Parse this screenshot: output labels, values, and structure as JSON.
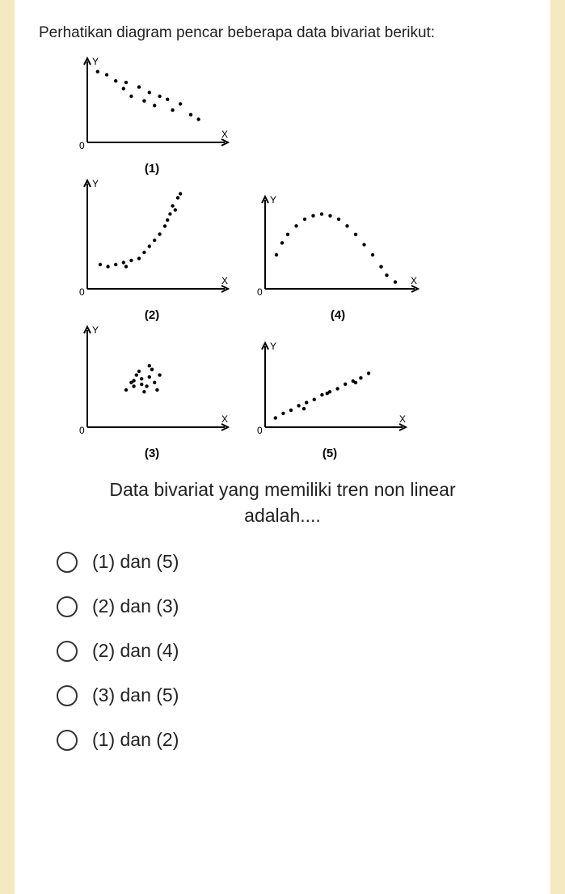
{
  "intro": "Perhatikan diagram pencar beberapa data bivariat berikut:",
  "question_line1": "Data bivariat yang memiliki tren non linear",
  "question_line2": "adalah....",
  "options": [
    "(1) dan (5)",
    "(2) dan (3)",
    "(2) dan (4)",
    "(3) dan (5)",
    "(1) dan (2)"
  ],
  "plots": {
    "p1": {
      "label": "(1)"
    },
    "p2": {
      "label": "(2)"
    },
    "p3": {
      "label": "(3)"
    },
    "p4": {
      "label": "(4)"
    },
    "p5": {
      "label": "(5)"
    }
  },
  "axis": {
    "x": "X",
    "y": "Y",
    "o": "0"
  },
  "chart_data": [
    {
      "type": "scatter",
      "label": "(1)",
      "description": "negative linear trend",
      "points": [
        [
          8,
          92
        ],
        [
          15,
          88
        ],
        [
          22,
          80
        ],
        [
          30,
          78
        ],
        [
          28,
          70
        ],
        [
          40,
          72
        ],
        [
          34,
          60
        ],
        [
          48,
          65
        ],
        [
          44,
          54
        ],
        [
          56,
          60
        ],
        [
          52,
          48
        ],
        [
          62,
          56
        ],
        [
          66,
          42
        ],
        [
          72,
          50
        ],
        [
          80,
          36
        ],
        [
          86,
          30
        ]
      ]
    },
    {
      "type": "scatter",
      "label": "(2)",
      "description": "curved upward (J-shape) non-linear",
      "points": [
        [
          10,
          24
        ],
        [
          16,
          22
        ],
        [
          22,
          24
        ],
        [
          28,
          26
        ],
        [
          34,
          28
        ],
        [
          30,
          22
        ],
        [
          40,
          30
        ],
        [
          44,
          36
        ],
        [
          48,
          42
        ],
        [
          52,
          48
        ],
        [
          56,
          54
        ],
        [
          60,
          62
        ],
        [
          62,
          68
        ],
        [
          64,
          74
        ],
        [
          66,
          82
        ],
        [
          70,
          90
        ],
        [
          68,
          78
        ],
        [
          72,
          94
        ]
      ]
    },
    {
      "type": "scatter",
      "label": "(3)",
      "description": "random cluster, no trend",
      "points": [
        [
          30,
          40
        ],
        [
          36,
          50
        ],
        [
          42,
          46
        ],
        [
          48,
          54
        ],
        [
          40,
          60
        ],
        [
          52,
          48
        ],
        [
          44,
          38
        ],
        [
          56,
          56
        ],
        [
          34,
          48
        ],
        [
          50,
          62
        ],
        [
          46,
          44
        ],
        [
          38,
          56
        ],
        [
          54,
          40
        ],
        [
          48,
          66
        ],
        [
          42,
          52
        ],
        [
          36,
          44
        ]
      ]
    },
    {
      "type": "scatter",
      "label": "(4)",
      "description": "inverted-U curve, non-linear",
      "points": [
        [
          8,
          40
        ],
        [
          12,
          54
        ],
        [
          16,
          64
        ],
        [
          22,
          74
        ],
        [
          28,
          82
        ],
        [
          34,
          86
        ],
        [
          40,
          88
        ],
        [
          46,
          86
        ],
        [
          52,
          82
        ],
        [
          58,
          74
        ],
        [
          64,
          64
        ],
        [
          70,
          52
        ],
        [
          76,
          40
        ],
        [
          82,
          26
        ],
        [
          86,
          16
        ],
        [
          92,
          8
        ]
      ]
    },
    {
      "type": "scatter",
      "label": "(5)",
      "description": "positive linear trend",
      "points": [
        [
          8,
          12
        ],
        [
          14,
          18
        ],
        [
          20,
          22
        ],
        [
          26,
          28
        ],
        [
          32,
          32
        ],
        [
          38,
          36
        ],
        [
          30,
          24
        ],
        [
          44,
          42
        ],
        [
          50,
          46
        ],
        [
          56,
          50
        ],
        [
          48,
          44
        ],
        [
          62,
          56
        ],
        [
          68,
          60
        ],
        [
          74,
          64
        ],
        [
          70,
          58
        ],
        [
          80,
          70
        ]
      ]
    }
  ]
}
